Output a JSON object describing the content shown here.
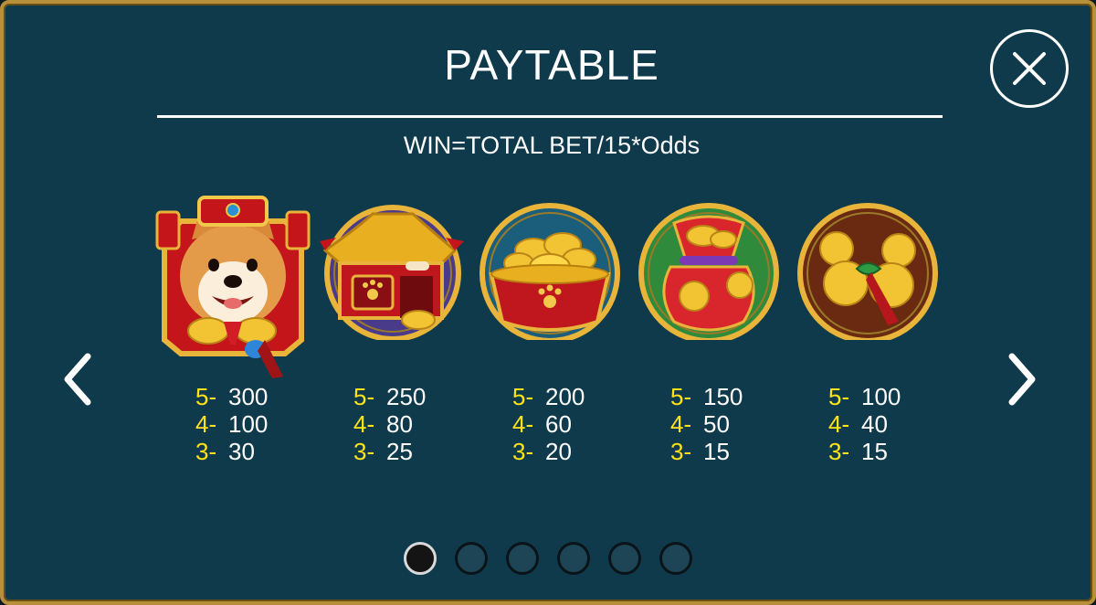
{
  "header": {
    "title": "PAYTABLE",
    "formula": "WIN=TOTAL BET/15*Odds"
  },
  "close_icon": "close-icon",
  "nav": {
    "prev_icon": "chevron-left-icon",
    "next_icon": "chevron-right-icon"
  },
  "symbols": [
    {
      "name": "shiba-dog-wild",
      "pays": [
        {
          "count": "5-",
          "value": "300"
        },
        {
          "count": "4-",
          "value": "100"
        },
        {
          "count": "3-",
          "value": "30"
        }
      ]
    },
    {
      "name": "dog-house",
      "pays": [
        {
          "count": "5-",
          "value": "250"
        },
        {
          "count": "4-",
          "value": "80"
        },
        {
          "count": "3-",
          "value": "25"
        }
      ]
    },
    {
      "name": "gold-ingot-bowl",
      "pays": [
        {
          "count": "5-",
          "value": "200"
        },
        {
          "count": "4-",
          "value": "60"
        },
        {
          "count": "3-",
          "value": "20"
        }
      ]
    },
    {
      "name": "lucky-money-bag",
      "pays": [
        {
          "count": "5-",
          "value": "150"
        },
        {
          "count": "4-",
          "value": "50"
        },
        {
          "count": "3-",
          "value": "15"
        }
      ]
    },
    {
      "name": "gold-gourd",
      "pays": [
        {
          "count": "5-",
          "value": "100"
        },
        {
          "count": "4-",
          "value": "40"
        },
        {
          "count": "3-",
          "value": "15"
        }
      ]
    }
  ],
  "pagination": {
    "total": 6,
    "current": 1
  },
  "colors": {
    "background": "#0f3a4b",
    "border_gold": "#b8903a",
    "count_yellow": "#ffe21a",
    "text_white": "#ffffff"
  }
}
